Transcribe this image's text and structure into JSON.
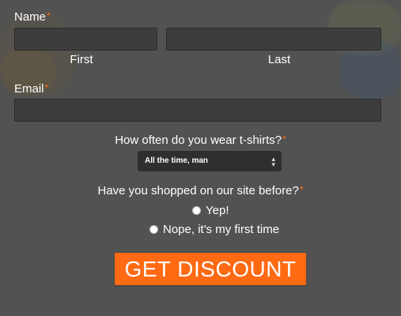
{
  "colors": {
    "background": "#525252",
    "input_background": "#3d3d3d",
    "required_marker": "#ff6a13",
    "accent_button": "#ff6a13",
    "text": "#ffffff"
  },
  "required_marker": "*",
  "name_field": {
    "label": "Name",
    "first_value": "",
    "last_value": "",
    "first_sublabel": "First",
    "last_sublabel": "Last"
  },
  "email_field": {
    "label": "Email",
    "value": ""
  },
  "tshirt_question": {
    "label": "How often do you wear t-shirts?",
    "selected": "All the time, man",
    "arrow_icon": "select-arrows-icon"
  },
  "shopped_question": {
    "label": "Have you shopped on our site before?",
    "options": [
      {
        "label": "Yep!",
        "checked": false
      },
      {
        "label": "Nope, it's my first time",
        "checked": false
      }
    ]
  },
  "submit": {
    "label": "GET DISCOUNT"
  }
}
